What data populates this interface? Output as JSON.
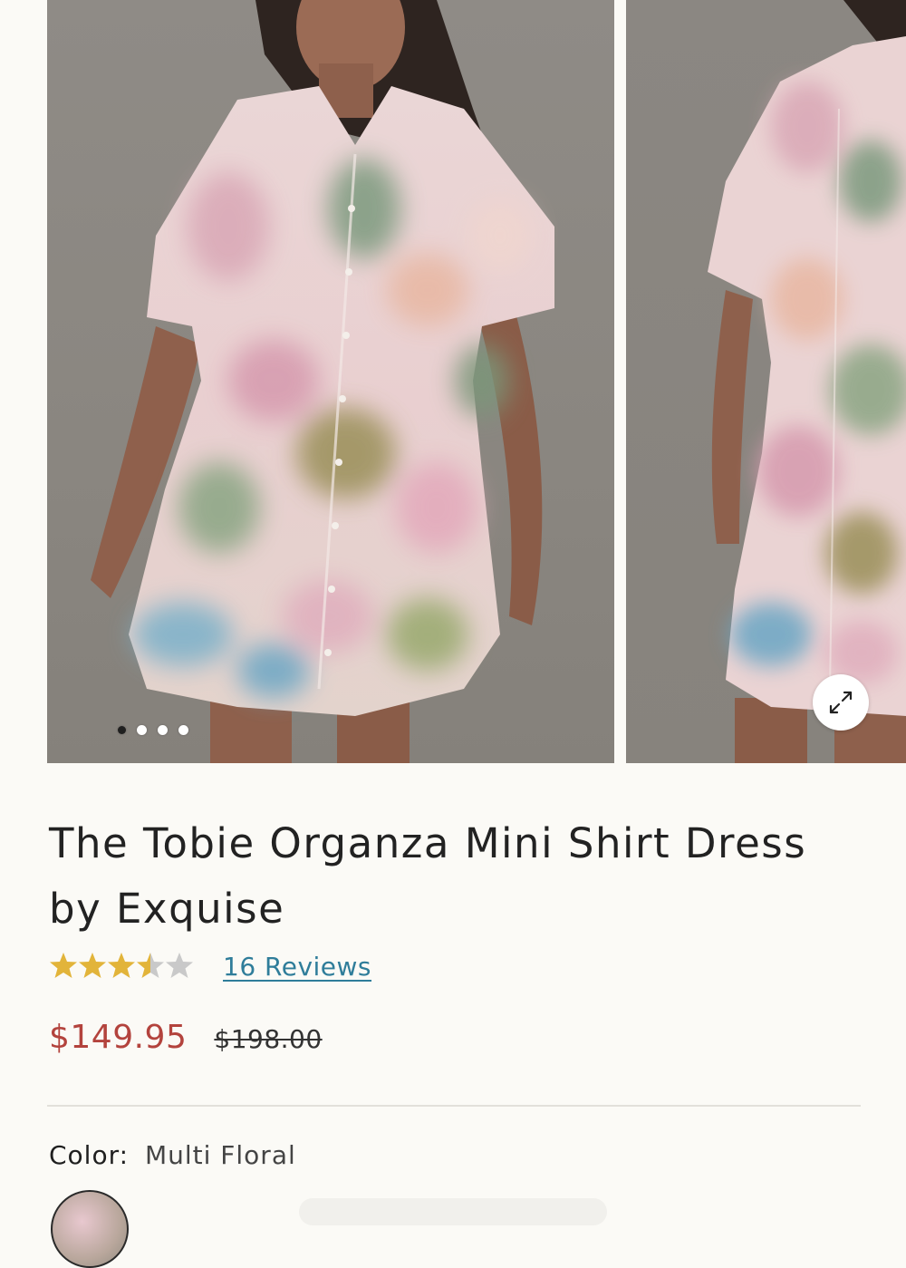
{
  "product": {
    "title": "The Tobie Organza Mini Shirt Dress by Exquise",
    "rating": {
      "value": 3.5,
      "max": 5,
      "reviews_label": "16 Reviews",
      "star_color": "#e2b43a",
      "empty_star_color": "#c9c9c9"
    },
    "price": {
      "sale": "$149.95",
      "original": "$198.00",
      "sale_color": "#b3433d"
    },
    "color": {
      "label": "Color:",
      "value": "Multi Floral"
    }
  },
  "gallery": {
    "dots": 4,
    "active_dot": 0,
    "expand_icon": "expand-arrows-icon"
  }
}
